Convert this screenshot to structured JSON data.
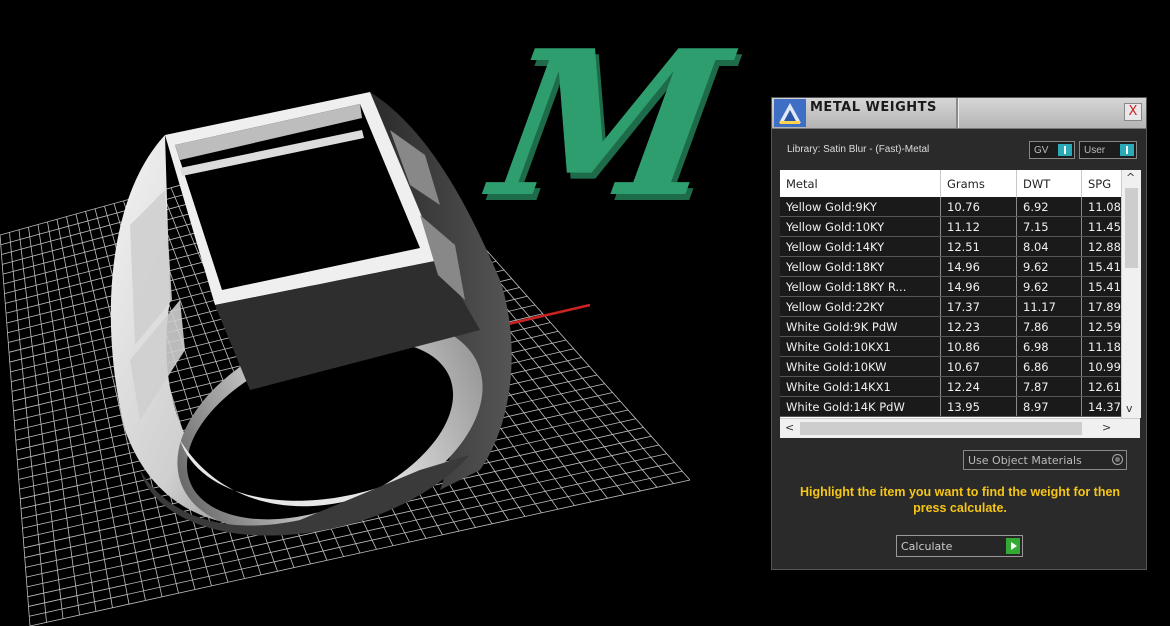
{
  "panel": {
    "title": "METAL WEIGHTS",
    "close_label": "X",
    "library": "Library: Satin Blur - (Fast)-Metal",
    "toggle_gv": "GV",
    "toggle_user": "User",
    "columns": [
      "Metal",
      "Grams",
      "DWT",
      "SPG"
    ],
    "rows": [
      [
        "Yellow Gold:9KY",
        "10.76",
        "6.92",
        "11.08"
      ],
      [
        "Yellow Gold:10KY",
        "11.12",
        "7.15",
        "11.45"
      ],
      [
        "Yellow Gold:14KY",
        "12.51",
        "8.04",
        "12.88"
      ],
      [
        "Yellow Gold:18KY",
        "14.96",
        "9.62",
        "15.41"
      ],
      [
        "Yellow Gold:18KY R...",
        "14.96",
        "9.62",
        "15.41"
      ],
      [
        "Yellow Gold:22KY",
        "17.37",
        "11.17",
        "17.89"
      ],
      [
        "White Gold:9K PdW",
        "12.23",
        "7.86",
        "12.59"
      ],
      [
        "White Gold:10KX1",
        "10.86",
        "6.98",
        "11.18"
      ],
      [
        "White Gold:10KW",
        "10.67",
        "6.86",
        "10.99"
      ],
      [
        "White Gold:14KX1",
        "12.24",
        "7.87",
        "12.61"
      ],
      [
        "White Gold:14K PdW",
        "13.95",
        "8.97",
        "14.37"
      ]
    ],
    "use_object_materials": "Use Object Materials",
    "hint": "Highlight the item you want to find the weight for then press calculate.",
    "calculate": "Calculate"
  },
  "viewport": {
    "monogram_letter": "M",
    "accent_colors": {
      "letter": "#2e9e6e",
      "x_axis": "#cc2222",
      "y_axis": "#2aa9c8",
      "grid": "#bfbfbf"
    }
  },
  "icons": [
    "app-icon",
    "close-icon",
    "scroll-up-icon",
    "scroll-down-icon",
    "scroll-left-icon",
    "scroll-right-icon",
    "calculate-arrow-icon"
  ]
}
